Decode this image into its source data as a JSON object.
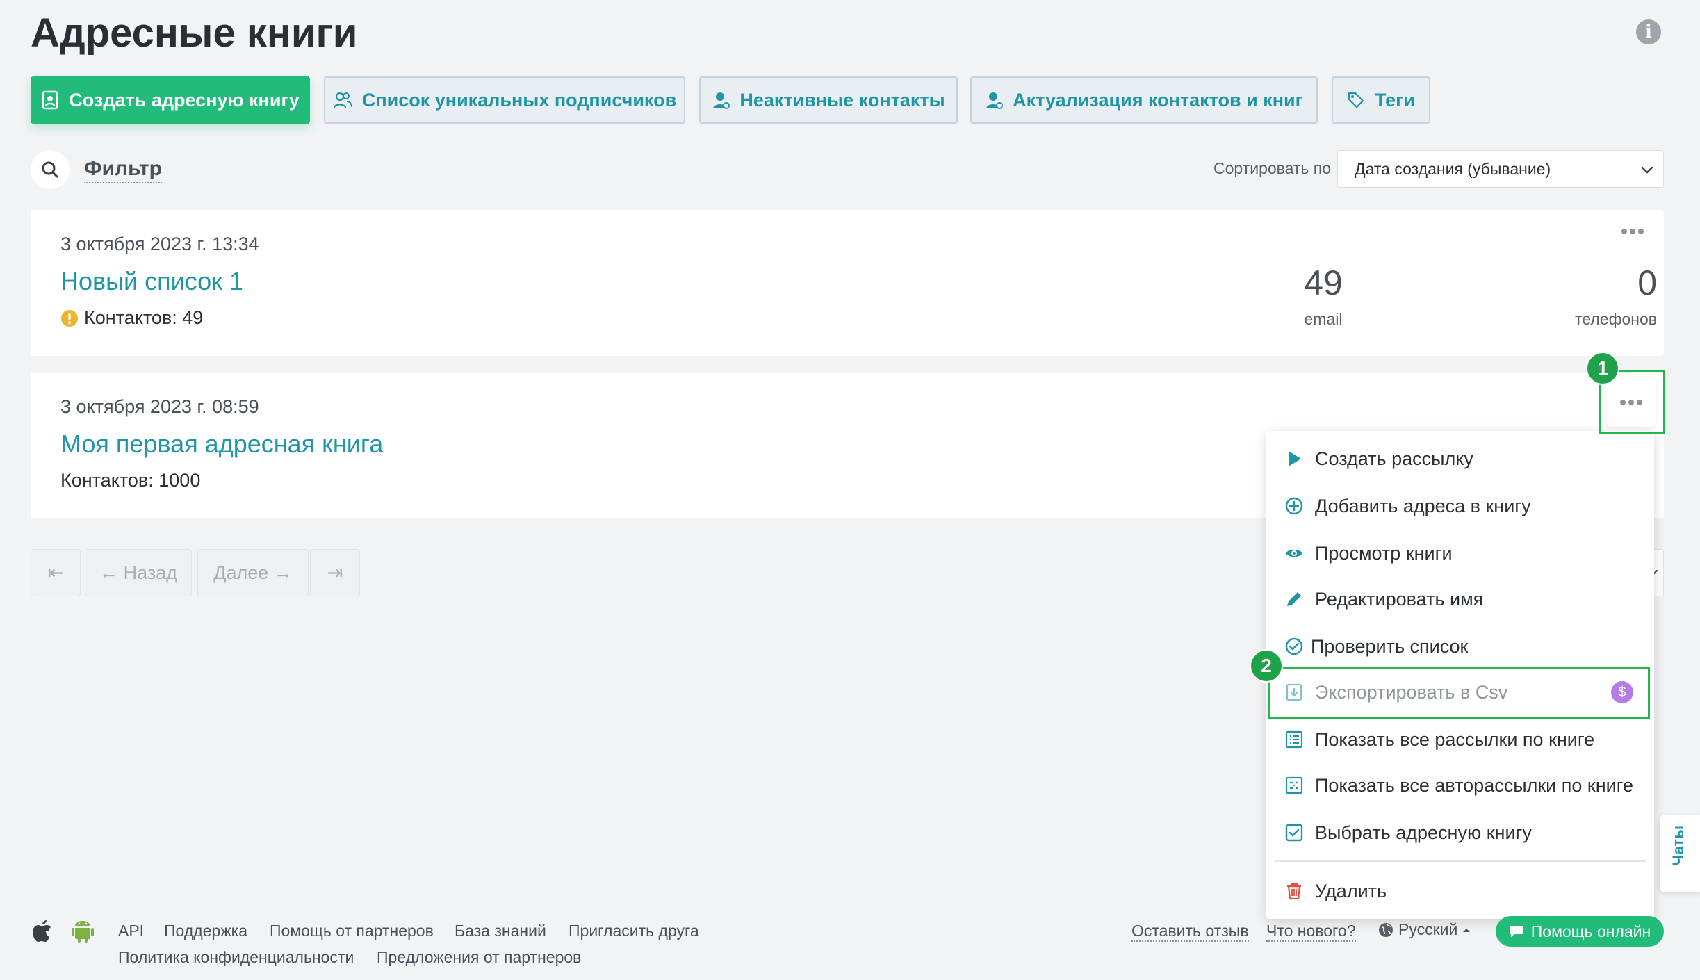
{
  "header": {
    "title": "Адресные книги",
    "toolbar": [
      {
        "label": "Создать адресную книгу",
        "icon": "address-book-icon"
      },
      {
        "label": "Список уникальных подписчиков",
        "icon": "users-icon"
      },
      {
        "label": "Неактивные контакты",
        "icon": "user-icon"
      },
      {
        "label": "Актуализация контактов и книг",
        "icon": "user-icon"
      },
      {
        "label": "Теги",
        "icon": "tag-icon"
      }
    ]
  },
  "filter": {
    "label": "Фильтр",
    "sort_label": "Сортировать по",
    "sort_value": "Дата создания (убывание)"
  },
  "books": [
    {
      "date": "3 октября 2023 г. 13:34",
      "name": "Новый список 1",
      "contacts": "Контактов: 49",
      "has_warning": true,
      "email_count": "49",
      "email_label": "email",
      "phone_count": "0",
      "phone_label": "телефонов"
    },
    {
      "date": "3 октября 2023 г. 08:59",
      "name": "Моя первая адресная книга",
      "contacts": "Контактов: 1000"
    }
  ],
  "pagination": {
    "first": "⇤",
    "prev": "← Назад",
    "next": "Далее →",
    "last": "⇥"
  },
  "menu": {
    "items": [
      {
        "label": "Создать рассылку",
        "icon": "play-icon"
      },
      {
        "label": "Добавить адреса в книгу",
        "icon": "plus-circle-icon"
      },
      {
        "label": "Просмотр книги",
        "icon": "eye-icon"
      },
      {
        "label": "Редактировать имя",
        "icon": "pencil-icon"
      },
      {
        "label": "Проверить список",
        "icon": "check-circle-icon"
      },
      {
        "label": "Экспортировать в Csv",
        "icon": "export-icon",
        "disabled": true,
        "paid_badge": "$"
      },
      {
        "label": "Показать все рассылки по книге",
        "icon": "list-icon"
      },
      {
        "label": "Показать все авторассылки по книге",
        "icon": "auto-list-icon"
      },
      {
        "label": "Выбрать адресную книгу",
        "icon": "checkbox-icon"
      },
      {
        "label": "Удалить",
        "icon": "trash-icon"
      }
    ]
  },
  "annotations": {
    "badge1": "1",
    "badge2": "2"
  },
  "footer": {
    "links_row1": [
      "API",
      "Поддержка",
      "Помощь от партнеров",
      "База знаний",
      "Пригласить друга"
    ],
    "links_row2": [
      "Политика конфиденциальности",
      "Предложения от партнеров"
    ],
    "feedback": "Оставить отзыв",
    "whats_new": "Что нового?",
    "language": "Русский",
    "help_online": "Помощь онлайн",
    "chats": "Чаты"
  },
  "colors": {
    "accent": "#1f95a6",
    "primary_green": "#21bb7a",
    "annotation_green": "#1fb84c",
    "warning": "#f0b429",
    "danger": "#e74c3c",
    "paid_badge": "#b57be8"
  }
}
